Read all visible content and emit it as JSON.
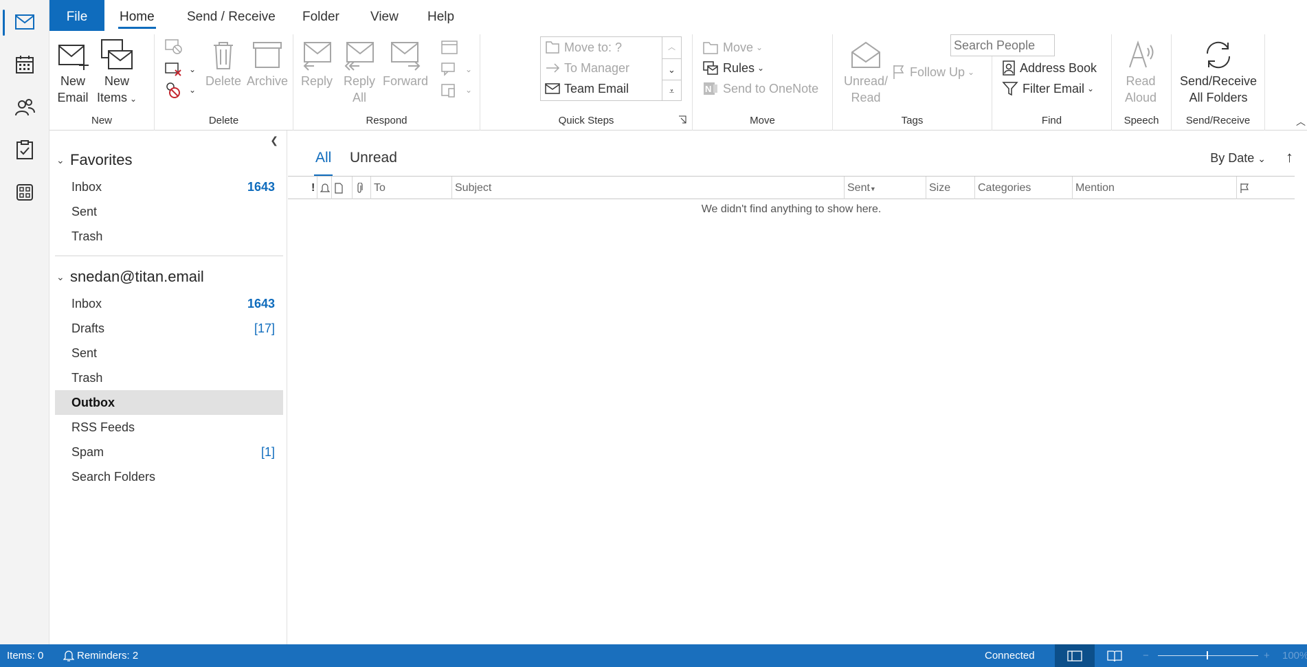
{
  "ribbon_tabs": {
    "file": "File",
    "home": "Home",
    "send_receive": "Send / Receive",
    "folder": "Folder",
    "view": "View",
    "help": "Help"
  },
  "ribbon": {
    "new": {
      "new_email": "New\nEmail",
      "new_email_l1": "New",
      "new_email_l2": "Email",
      "new_items_l1": "New",
      "new_items_l2": "Items",
      "label": "New"
    },
    "delete": {
      "delete": "Delete",
      "archive": "Archive",
      "label": "Delete"
    },
    "respond": {
      "reply": "Reply",
      "reply_all_l1": "Reply",
      "reply_all_l2": "All",
      "forward": "Forward",
      "label": "Respond"
    },
    "quick_steps": {
      "move_to": "Move to: ?",
      "to_manager": "To Manager",
      "team_email": "Team Email",
      "label": "Quick Steps"
    },
    "move": {
      "move": "Move",
      "rules": "Rules",
      "send_to_onenote": "Send to OneNote",
      "label": "Move"
    },
    "tags": {
      "unread_l1": "Unread/",
      "unread_l2": "Read",
      "follow_up": "Follow Up",
      "label": "Tags"
    },
    "find": {
      "search_people": "Search People",
      "address_book": "Address Book",
      "filter_email": "Filter Email",
      "label": "Find"
    },
    "speech": {
      "read_l1": "Read",
      "read_l2": "Aloud",
      "label": "Speech"
    },
    "send_receive": {
      "sr_l1": "Send/Receive",
      "sr_l2": "All Folders",
      "label": "Send/Receive"
    }
  },
  "folders": {
    "favorites": {
      "title": "Favorites",
      "items": [
        {
          "label": "Inbox",
          "count": "1643"
        },
        {
          "label": "Sent",
          "count": ""
        },
        {
          "label": "Trash",
          "count": ""
        }
      ]
    },
    "account": {
      "title": "snedan@titan.email",
      "items": [
        {
          "label": "Inbox",
          "count": "1643"
        },
        {
          "label": "Drafts",
          "count": "[17]"
        },
        {
          "label": "Sent",
          "count": ""
        },
        {
          "label": "Trash",
          "count": ""
        },
        {
          "label": "Outbox",
          "count": ""
        },
        {
          "label": "RSS Feeds",
          "count": ""
        },
        {
          "label": "Spam",
          "count": "[1]"
        },
        {
          "label": "Search Folders",
          "count": ""
        }
      ],
      "selected": "Outbox"
    }
  },
  "message_list": {
    "tabs": {
      "all": "All",
      "unread": "Unread"
    },
    "sort": "By Date",
    "columns": {
      "importance": "!",
      "to": "To",
      "subject": "Subject",
      "sent": "Sent",
      "size": "Size",
      "categories": "Categories",
      "mention": "Mention"
    },
    "empty_text": "We didn't find anything to show here."
  },
  "status_bar": {
    "items": "Items: 0",
    "reminders": "Reminders: 2",
    "connection": "Connected",
    "zoom": "100%"
  },
  "colors": {
    "accent": "#0f6cbd",
    "statusbar": "#1a6fbd"
  }
}
